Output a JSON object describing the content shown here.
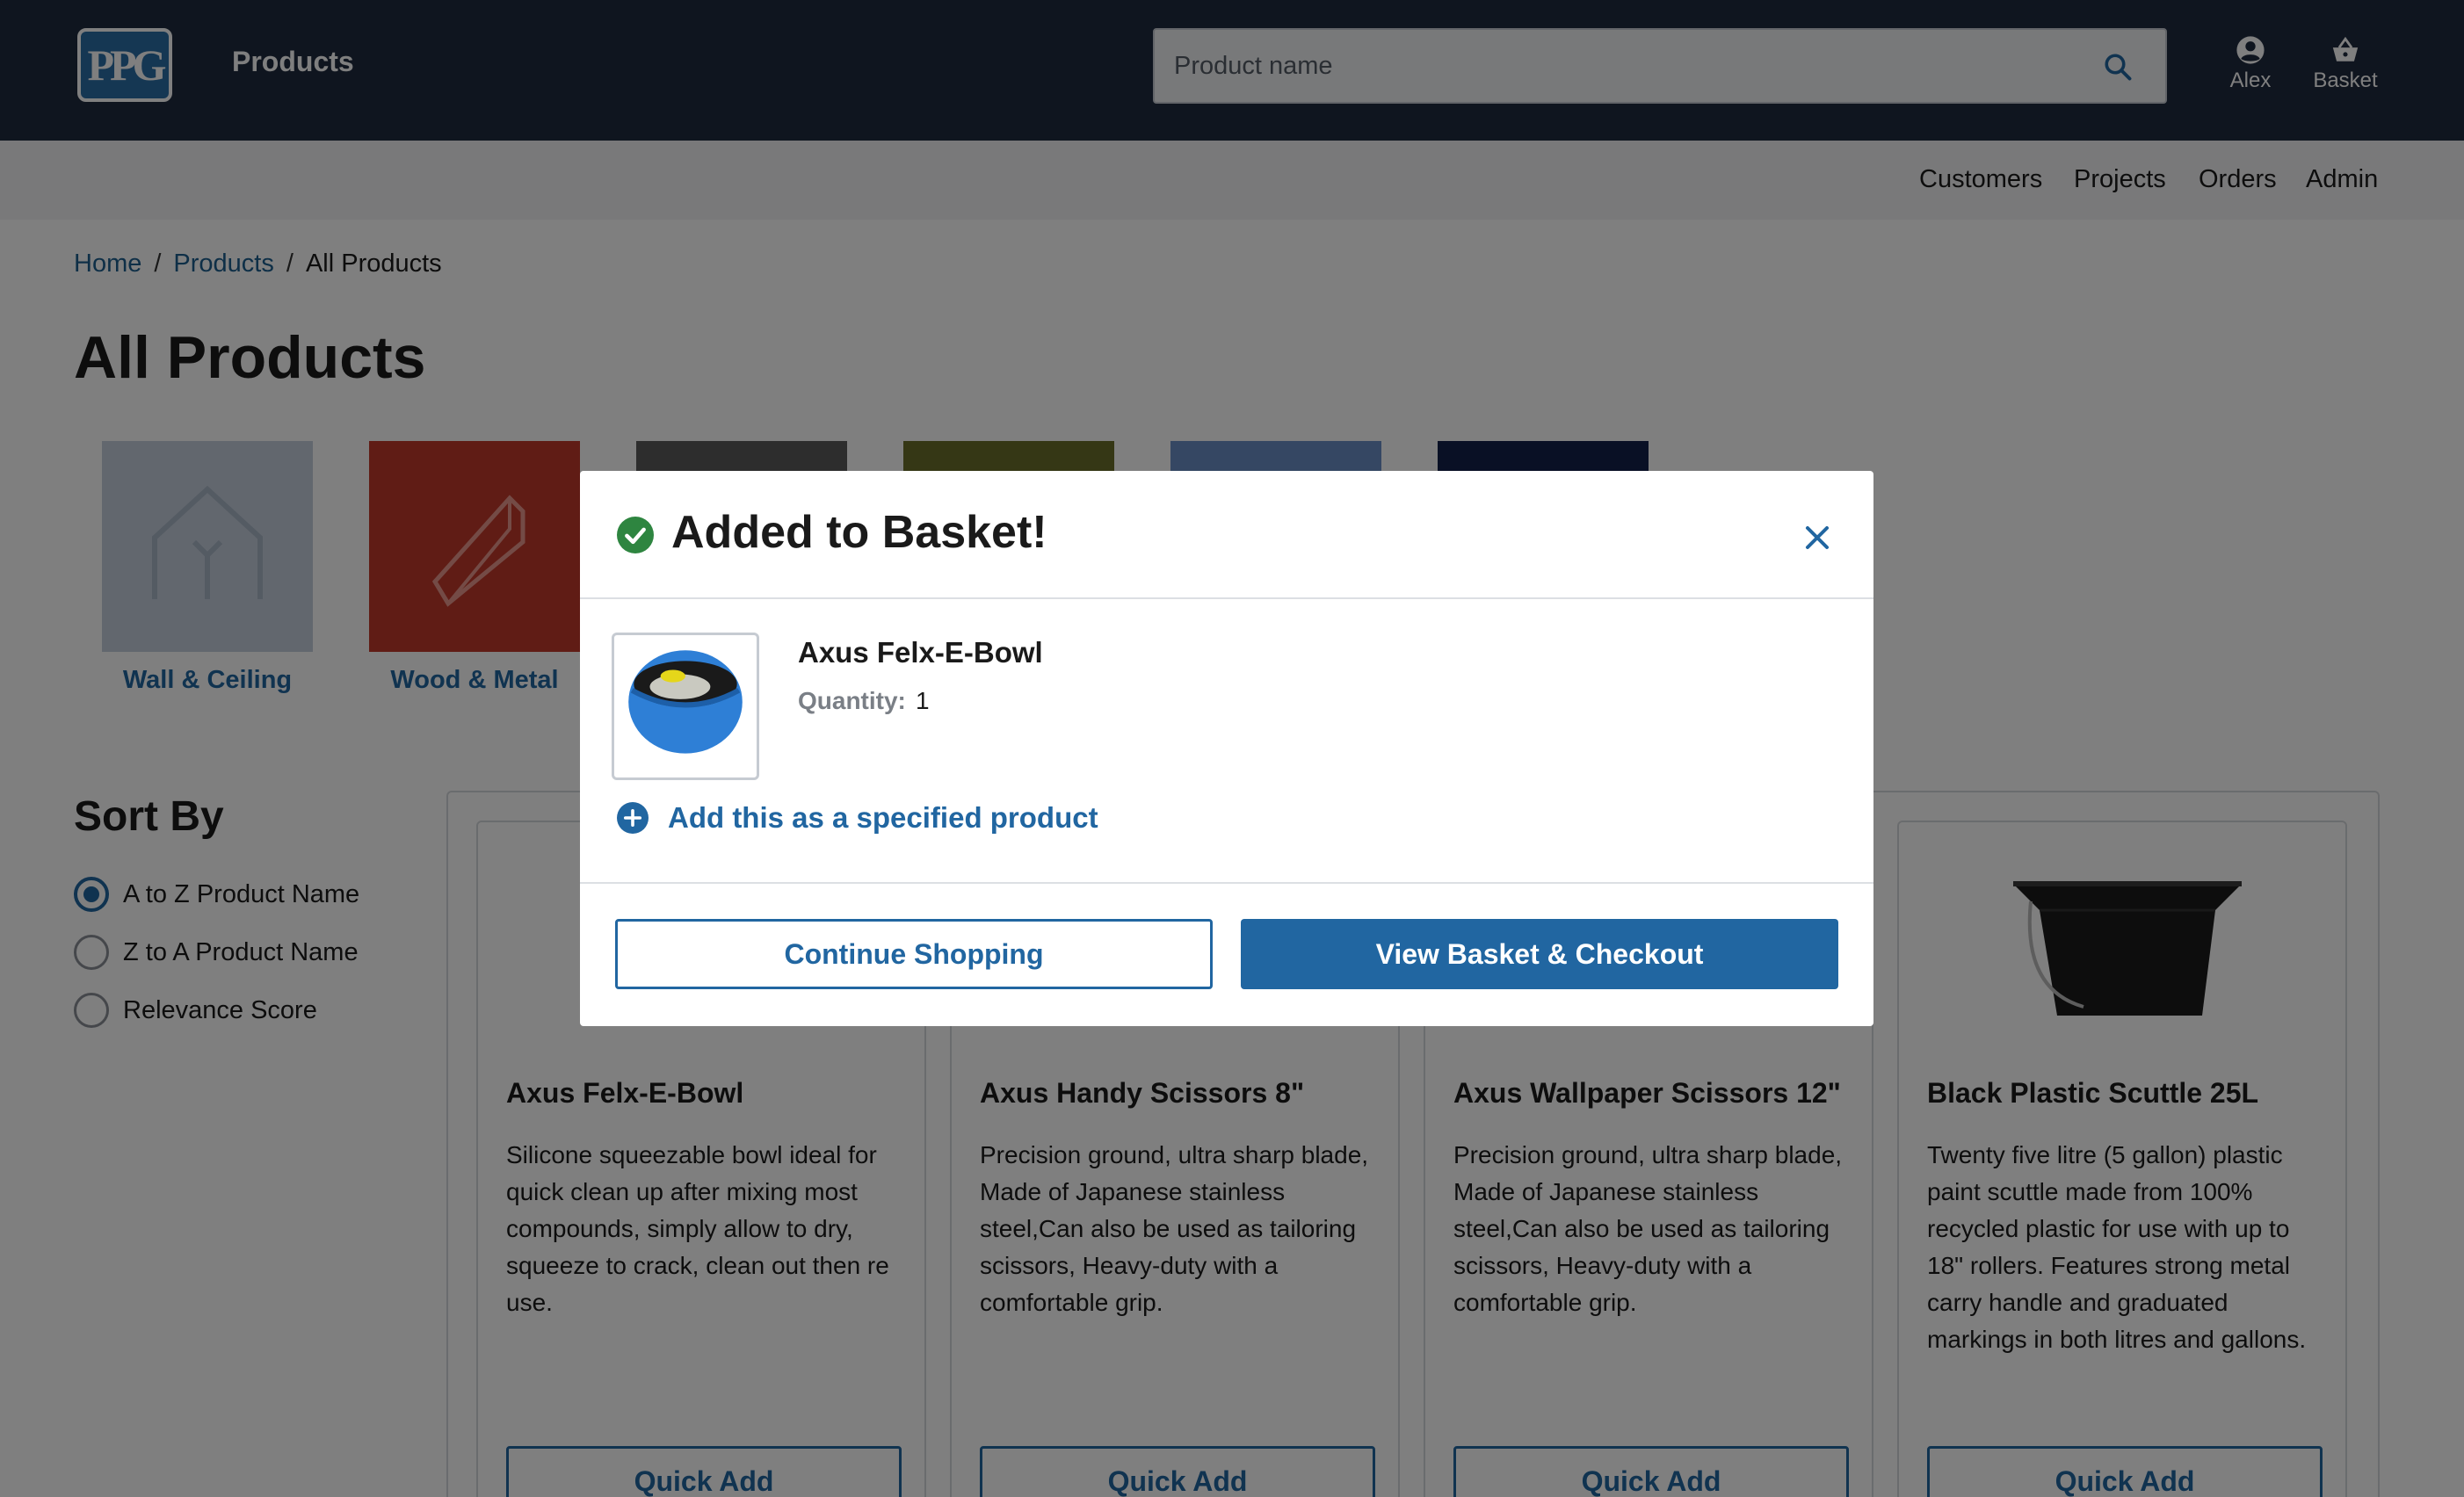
{
  "header": {
    "logo_text": "PPG",
    "app_title": "Products",
    "search_placeholder": "Product name",
    "user_label": "Alex",
    "basket_label": "Basket"
  },
  "subnav": {
    "items": [
      "Customers",
      "Projects",
      "Orders",
      "Admin"
    ]
  },
  "breadcrumb": {
    "home": "Home",
    "products": "Products",
    "current": "All Products",
    "separator": "/"
  },
  "page_title": "All Products",
  "categories": [
    {
      "label": "Wall & Ceiling",
      "color": "#c4cfdc"
    },
    {
      "label": "Wood & Metal",
      "color": "#c0392b"
    },
    {
      "label": "",
      "color": "#5a5a5a"
    },
    {
      "label": "",
      "color": "#6b6e2a"
    },
    {
      "label": "",
      "color": "#6b8fc6"
    },
    {
      "label": "",
      "color": "#13204a"
    }
  ],
  "sort": {
    "title": "Sort By",
    "options": [
      {
        "label": "A to Z Product Name",
        "selected": true
      },
      {
        "label": "Z to A Product Name",
        "selected": false
      },
      {
        "label": "Relevance Score",
        "selected": false
      }
    ]
  },
  "products": [
    {
      "name": "Axus Felx-E-Bowl",
      "description": "Silicone squeezable bowl ideal for quick clean up after mixing most compounds, simply allow to dry, squeeze to crack, clean out then re use.",
      "button": "Quick Add"
    },
    {
      "name": "Axus Handy Scissors 8\"",
      "description": "Precision ground, ultra sharp blade, Made of Japanese stainless steel,Can also be used as tailoring scissors, Heavy-duty with a comfortable grip.",
      "button": "Quick Add"
    },
    {
      "name": "Axus Wallpaper Scissors 12\"",
      "description": "Precision ground, ultra sharp blade, Made of Japanese stainless steel,Can also be used as tailoring scissors, Heavy-duty with a comfortable grip.",
      "button": "Quick Add"
    },
    {
      "name": "Black Plastic Scuttle 25L",
      "description": "Twenty five litre (5 gallon) plastic paint scuttle made from 100% recycled plastic for use with up to 18\" rollers. Features strong metal carry handle and graduated markings in both litres and gallons.",
      "button": "Quick Add"
    }
  ],
  "modal": {
    "title": "Added to Basket!",
    "item_name": "Axus Felx-E-Bowl",
    "quantity_label": "Quantity:",
    "quantity_value": "1",
    "specify_label": "Add this as a specified product",
    "continue_label": "Continue Shopping",
    "checkout_label": "View Basket & Checkout"
  },
  "colors": {
    "header_bg": "#1e2a3e",
    "accent": "#2166a1",
    "success": "#2e8540"
  }
}
